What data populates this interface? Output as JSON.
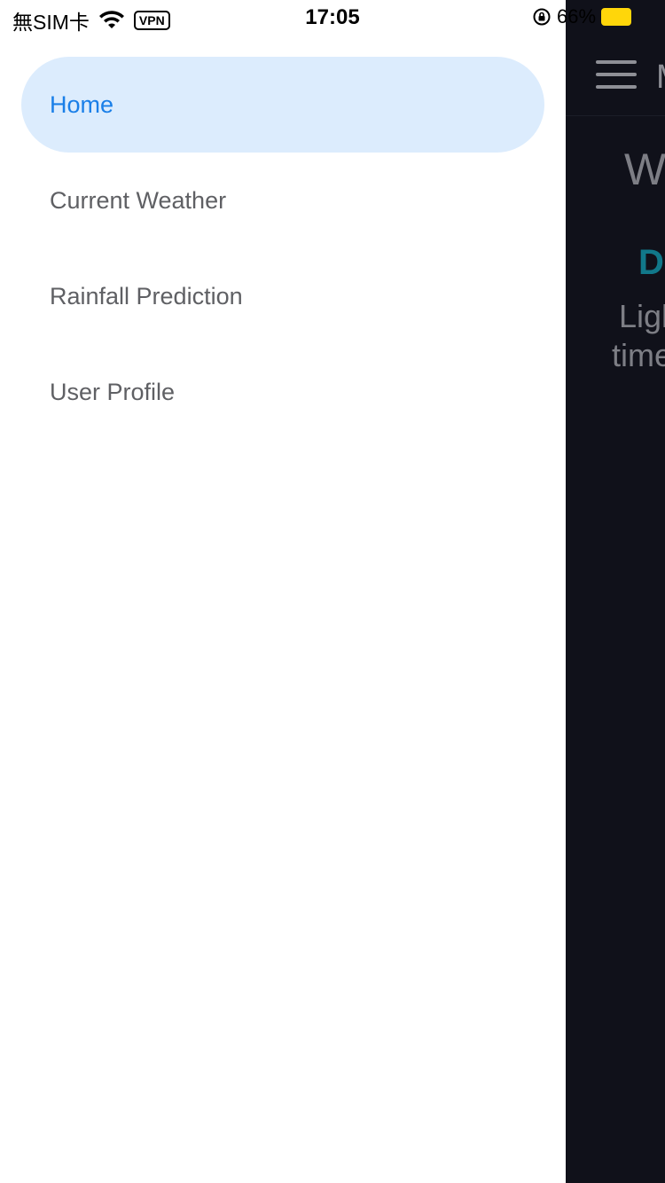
{
  "status_bar": {
    "carrier": "無SIM卡",
    "vpn": "VPN",
    "time": "17:05",
    "battery": "66%"
  },
  "drawer": {
    "items": [
      {
        "label": "Home",
        "active": true
      },
      {
        "label": "Current Weather",
        "active": false
      },
      {
        "label": "Rainfall Prediction",
        "active": false
      },
      {
        "label": "User Profile",
        "active": false
      }
    ]
  },
  "background": {
    "title_fragment": "M",
    "heading_fragment": "We",
    "teal_fragment": "D",
    "line1_fragment": "Ligl",
    "line2_fragment": "time"
  },
  "colors": {
    "accent": "#1a7fe8",
    "active_bg": "#dcecfd",
    "background_app": "#10111a",
    "teal": "#11788a",
    "battery": "#ffd60a"
  }
}
